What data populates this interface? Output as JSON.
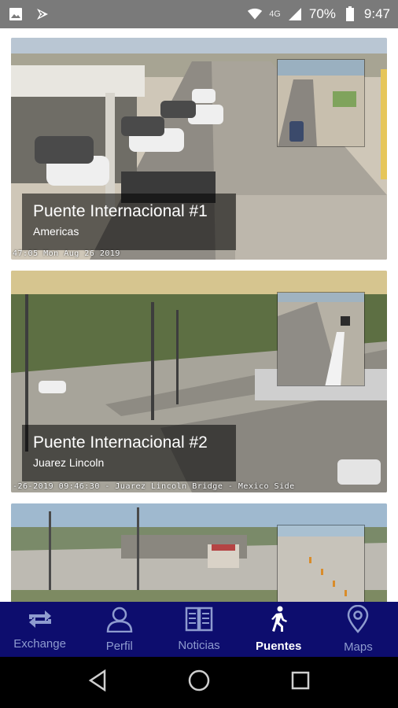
{
  "status_bar": {
    "network": "4G",
    "battery": "70%",
    "time": "9:47"
  },
  "cameras": [
    {
      "title": "Puente Internacional #1",
      "subtitle": "Americas",
      "timestamp": "47:05 Mon Aug 26 2019"
    },
    {
      "title": "Puente Internacional #2",
      "subtitle": "Juarez Lincoln",
      "timestamp": "-26-2019 09:46:30 - Juarez Lincoln Bridge - Mexico Side"
    },
    {
      "title": "",
      "subtitle": "",
      "timestamp": ""
    }
  ],
  "bottom_nav": {
    "items": [
      {
        "label": "Exchange",
        "icon": "exchange-icon"
      },
      {
        "label": "Perfil",
        "icon": "person-icon"
      },
      {
        "label": "Noticias",
        "icon": "newspaper-icon"
      },
      {
        "label": "Puentes",
        "icon": "walking-icon",
        "active": true
      },
      {
        "label": "Maps",
        "icon": "map-pin-icon"
      }
    ],
    "active_color": "#ffffff",
    "inactive_color": "#8e9bcf",
    "background": "#0d0d6e"
  }
}
